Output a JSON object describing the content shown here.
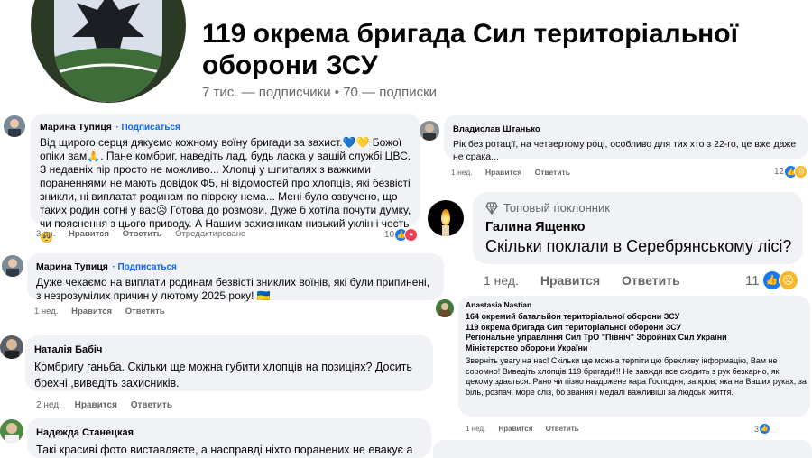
{
  "header": {
    "title": "119 окрема бригада Сил територіальної оборони ЗСУ",
    "stats": "7 тис. — подписчики • 70 — подписки"
  },
  "comments": [
    {
      "author": "Марина Тупиця",
      "follow": "Подписаться",
      "text": "Від щирого серця дякуємо кожному воїну бригади за захист.💙💛 Божої опіки вам🙏. Пане комбриг, наведіть лад, будь ласка у вашій службі ЦВС. З недавніх пір просто не можливо... Хлопці у шпиталях з важкими пораненнями не мають довідок Ф5, ні відомостей про хлопців, які безвісті зникли, ні виплатат родинам по півроку нема... Мені було озвучено, що таких родин сотні у вас😥 Готова до розмови. Дуже б хотіла почути думку, чи пояснення з цього приводу. А Нашим захисникам низький уклін і честь🥺",
      "time": "3 дн.",
      "like": "Нравится",
      "reply": "Ответить",
      "edited": "Отредактировано",
      "count": "10"
    },
    {
      "author": "Марина Тупиця",
      "follow": "Подписаться",
      "text": "Дуже чекаємо на виплати родинам безвісті зниклих воїнів, які були припинені, з незрозумілих причин у лютому 2025 року! 🇺🇦",
      "time": "1 нед.",
      "like": "Нравится",
      "reply": "Ответить"
    },
    {
      "author": "Наталія Бабіч",
      "text": "Комбригу ганьба. Скільки ще можна губити хлопців на позиціях? Досить брехні ,виведіть захисників.",
      "time": "2 нед.",
      "like": "Нравится",
      "reply": "Ответить"
    },
    {
      "author": "Надежда Станецкая",
      "text": "Такі красиві фото виставляєте, а насправді ніхто поранених не евакує а"
    }
  ],
  "right_comments": [
    {
      "author": "Владислав Штанько",
      "text": "Рік без ротації, на четвертому році, особливо для тих хто з 22-го, це вже даже не срака...",
      "time": "1 нед.",
      "like": "Нравится",
      "reply": "Ответить",
      "count": "12"
    },
    {
      "badge": "Топовый поклонник",
      "author": "Галина Ященко",
      "text": "Скільки поклали в Серебрянському лісі?",
      "time": "1 нед.",
      "like": "Нравится",
      "reply": "Ответить",
      "count": "11"
    },
    {
      "author": "Anastasia Nastian",
      "tags": "164 окремий батальйон територіальної оборони ЗСУ\n119 окрема бригада Сил територіальної оборони ЗСУ\nРегіональне управління Сил ТрО \"Північ\" Збройних Сил України\nМіністерство оборони України",
      "text": "Зверніть увагу на нас! Скільки ще можна терпіти цю брехливу інформацію, Вам не соромно! Виведіть хлопців 119 бригади!!! Не завжди все сходить з рук безкарно, як декому здається. Рано чи пізно наздожене кара Господня, за кров, яка на Ваших руках, за біль, розпач, море сліз, бо звання і медалі важливіші за людські життя.",
      "time": "1 нед.",
      "like": "Нравится",
      "reply": "Ответить",
      "count": "3"
    }
  ],
  "colors": {
    "link": "#0866ff",
    "bubble": "#f0f2f5",
    "meta": "#65676b"
  }
}
